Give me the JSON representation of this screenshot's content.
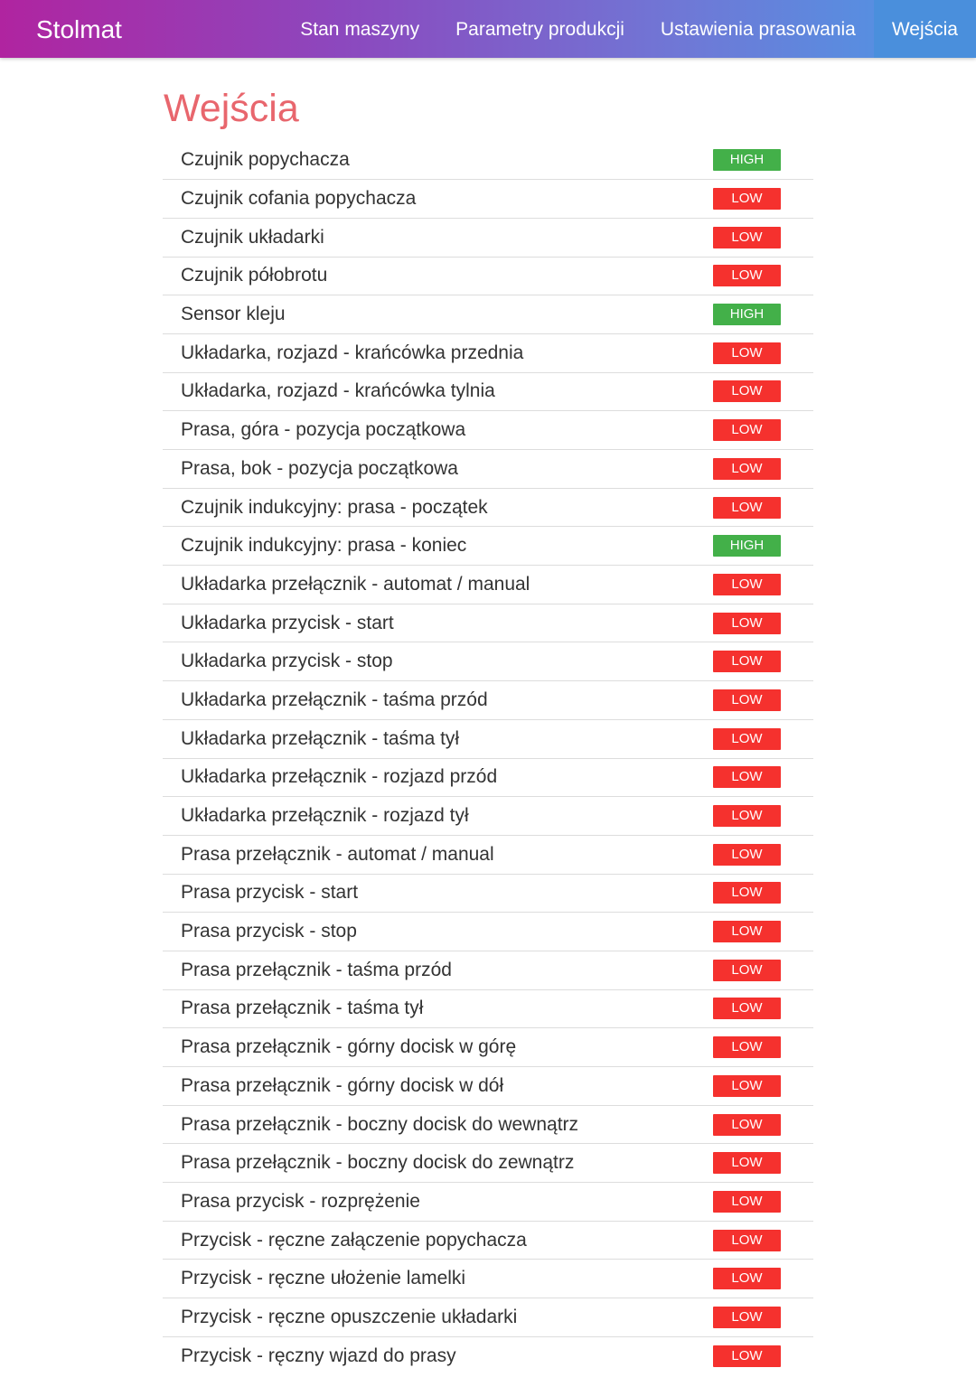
{
  "brand": "Stolmat",
  "nav": {
    "items": [
      {
        "label": "Stan maszyny",
        "active": false
      },
      {
        "label": "Parametry produkcji",
        "active": false
      },
      {
        "label": "Ustawienia prasowania",
        "active": false
      },
      {
        "label": "Wejścia",
        "active": true
      }
    ]
  },
  "page": {
    "title": "Wejścia"
  },
  "colors": {
    "title": "#e8666d",
    "high": "#43b049",
    "low": "#f5312e",
    "nav_active": "#4a8fdc"
  },
  "inputs": [
    {
      "name": "Czujnik popychacza",
      "state": "HIGH"
    },
    {
      "name": "Czujnik cofania popychacza",
      "state": "LOW"
    },
    {
      "name": "Czujnik układarki",
      "state": "LOW"
    },
    {
      "name": "Czujnik półobrotu",
      "state": "LOW"
    },
    {
      "name": "Sensor kleju",
      "state": "HIGH"
    },
    {
      "name": "Układarka, rozjazd - krańcówka przednia",
      "state": "LOW"
    },
    {
      "name": "Układarka, rozjazd - krańcówka tylnia",
      "state": "LOW"
    },
    {
      "name": "Prasa, góra - pozycja początkowa",
      "state": "LOW"
    },
    {
      "name": "Prasa, bok - pozycja początkowa",
      "state": "LOW"
    },
    {
      "name": "Czujnik indukcyjny: prasa - początek",
      "state": "LOW"
    },
    {
      "name": "Czujnik indukcyjny: prasa - koniec",
      "state": "HIGH"
    },
    {
      "name": "Układarka przełącznik - automat / manual",
      "state": "LOW"
    },
    {
      "name": "Układarka przycisk - start",
      "state": "LOW"
    },
    {
      "name": "Układarka przycisk - stop",
      "state": "LOW"
    },
    {
      "name": "Układarka przełącznik - taśma przód",
      "state": "LOW"
    },
    {
      "name": "Układarka przełącznik - taśma tył",
      "state": "LOW"
    },
    {
      "name": "Układarka przełącznik - rozjazd przód",
      "state": "LOW"
    },
    {
      "name": "Układarka przełącznik - rozjazd tył",
      "state": "LOW"
    },
    {
      "name": "Prasa przełącznik - automat / manual",
      "state": "LOW"
    },
    {
      "name": "Prasa przycisk - start",
      "state": "LOW"
    },
    {
      "name": "Prasa przycisk - stop",
      "state": "LOW"
    },
    {
      "name": "Prasa przełącznik - taśma przód",
      "state": "LOW"
    },
    {
      "name": "Prasa przełącznik - taśma tył",
      "state": "LOW"
    },
    {
      "name": "Prasa przełącznik - górny docisk w górę",
      "state": "LOW"
    },
    {
      "name": "Prasa przełącznik - górny docisk w dół",
      "state": "LOW"
    },
    {
      "name": "Prasa przełącznik - boczny docisk do wewnątrz",
      "state": "LOW"
    },
    {
      "name": "Prasa przełącznik - boczny docisk do zewnątrz",
      "state": "LOW"
    },
    {
      "name": "Prasa przycisk - rozprężenie",
      "state": "LOW"
    },
    {
      "name": "Przycisk - ręczne załączenie popychacza",
      "state": "LOW"
    },
    {
      "name": "Przycisk - ręczne ułożenie lamelki",
      "state": "LOW"
    },
    {
      "name": "Przycisk - ręczne opuszczenie układarki",
      "state": "LOW"
    },
    {
      "name": "Przycisk - ręczny wjazd do prasy",
      "state": "LOW"
    }
  ]
}
